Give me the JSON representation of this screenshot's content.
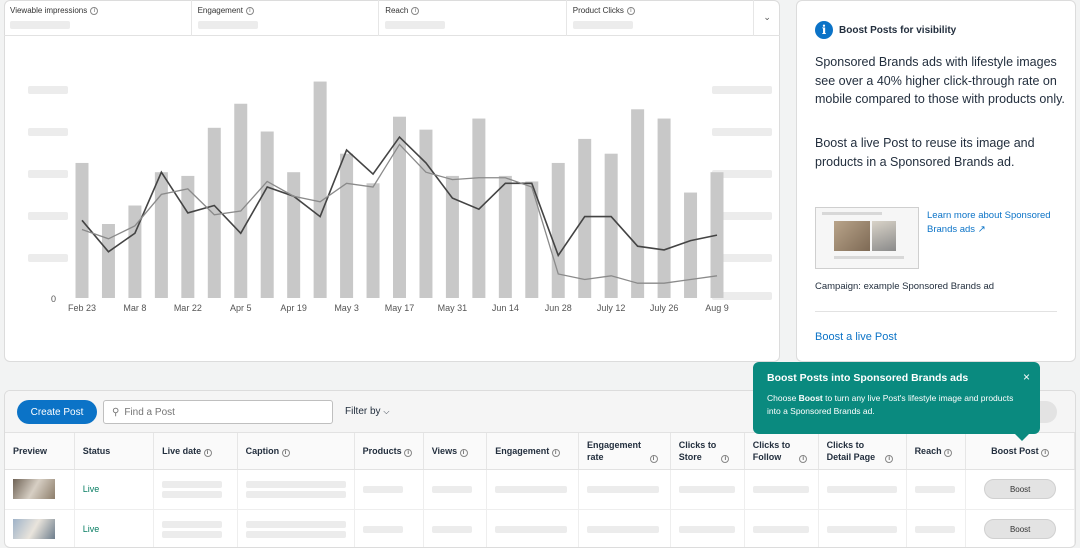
{
  "metrics": [
    {
      "label": "Viewable impressions"
    },
    {
      "label": "Engagement"
    },
    {
      "label": "Reach"
    },
    {
      "label": "Product Clicks"
    }
  ],
  "chart_data": {
    "type": "bar",
    "categories": [
      "Feb 23",
      "",
      "Mar 8",
      "",
      "Mar 22",
      "",
      "Apr 5",
      "",
      "Apr 19",
      "",
      "May 3",
      "",
      "May 17",
      "",
      "May 31",
      "",
      "Jun 14",
      "",
      "Jun 28",
      "",
      "July 12",
      "",
      "July 26",
      "",
      "Aug 9"
    ],
    "x_tick_labels": [
      "Feb 23",
      "Mar 8",
      "Mar 22",
      "Apr 5",
      "Apr 19",
      "May 3",
      "May 17",
      "May 31",
      "Jun 14",
      "Jun 28",
      "July 12",
      "July 26",
      "Aug 9"
    ],
    "series": [
      {
        "type": "bar",
        "values": [
          73,
          40,
          50,
          68,
          66,
          92,
          105,
          90,
          68,
          117,
          78,
          62,
          98,
          91,
          66,
          97,
          66,
          63,
          73,
          86,
          78,
          102,
          97,
          57,
          68
        ]
      },
      {
        "type": "line",
        "values": [
          42,
          25,
          35,
          68,
          46,
          50,
          35,
          60,
          55,
          44,
          80,
          67,
          87,
          73,
          54,
          48,
          62,
          62,
          23,
          44,
          44,
          28,
          26,
          31,
          34
        ]
      },
      {
        "type": "line",
        "values": [
          37,
          32,
          39,
          56,
          59,
          45,
          47,
          63,
          55,
          52,
          62,
          60,
          83,
          68,
          64,
          65,
          65,
          60,
          13,
          10,
          12,
          8,
          8,
          10,
          12
        ]
      }
    ],
    "y_tick_labels": [
      "0"
    ]
  },
  "sidebar": {
    "title": "Boost Posts for visibility",
    "para1": "Sponsored Brands ads with lifestyle images see over a 40% higher click-through rate on mobile compared to those with products only.",
    "para2": "Boost a live Post to reuse its image and products in a Sponsored Brands ad.",
    "learn_more": "Learn more about Sponsored Brands ads",
    "campaign": "Campaign: example Sponsored Brands ad",
    "boost_link": "Boost a live Post"
  },
  "popover": {
    "title": "Boost Posts into Sponsored Brands ads",
    "body_pre": "Choose ",
    "body_bold": "Boost",
    "body_post": " to turn any live Post's lifestyle image and products into a Sponsored Brands ad.",
    "close": "×"
  },
  "toolbar": {
    "create_post": "Create Post",
    "search_placeholder": "Find a Post",
    "filter_by": "Filter by"
  },
  "table": {
    "headers": [
      "Preview",
      "Status",
      "Live date",
      "Caption",
      "Products",
      "Views",
      "Engagement",
      "Engagement rate",
      "Clicks to Store",
      "Clicks to Follow",
      "Clicks to Detail Page",
      "Reach",
      "Boost Post"
    ],
    "rows": [
      {
        "status": "Live",
        "boost": "Boost"
      },
      {
        "status": "Live",
        "boost": "Boost"
      }
    ]
  }
}
